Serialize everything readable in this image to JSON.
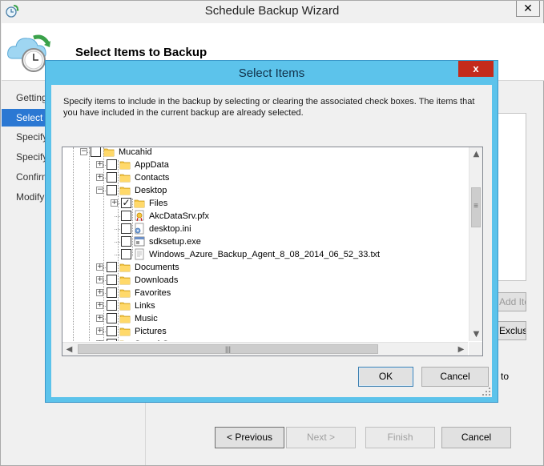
{
  "outer_window": {
    "title": "Schedule Backup Wizard",
    "close_glyph": "✕",
    "icon": "backup-schedule-icon"
  },
  "header": {
    "title": "Select Items to Backup",
    "icon": "cloud-clock-icon"
  },
  "steps": [
    {
      "label": "Getting Started",
      "active": false
    },
    {
      "label": "Select Items to Backup",
      "active": true
    },
    {
      "label": "Specify Backup Time",
      "active": false
    },
    {
      "label": "Specify Retention Policy",
      "active": false
    },
    {
      "label": "Confirmation",
      "active": false
    },
    {
      "label": "Modify Backup Progress",
      "active": false
    }
  ],
  "background_buttons": {
    "btn1_label": "Add Items",
    "btn2_label": "Exclusion Settings",
    "side_text": "to"
  },
  "bottom_buttons": {
    "previous": "< Previous",
    "next": "Next >",
    "finish": "Finish",
    "cancel": "Cancel"
  },
  "dialog": {
    "title": "Select Items",
    "close_glyph": "x",
    "instructions": "Specify items to include in the backup by selecting or clearing the associated check boxes. The items that you have included in the current backup are already selected.",
    "ok_label": "OK",
    "cancel_label": "Cancel",
    "tree": [
      {
        "label": "Mucahid",
        "icon": "folder",
        "expander": "minus",
        "checked": false
      },
      {
        "label": "AppData",
        "icon": "folder",
        "expander": "plus",
        "checked": false
      },
      {
        "label": "Contacts",
        "icon": "folder",
        "expander": "plus",
        "checked": false
      },
      {
        "label": "Desktop",
        "icon": "folder",
        "expander": "minus",
        "checked": false
      },
      {
        "label": "Files",
        "icon": "folder",
        "expander": "plus",
        "checked": true
      },
      {
        "label": "AkcDataSrv.pfx",
        "icon": "certificate-file",
        "expander": "none",
        "checked": false
      },
      {
        "label": "desktop.ini",
        "icon": "settings-file",
        "expander": "none",
        "checked": false
      },
      {
        "label": "sdksetup.exe",
        "icon": "executable-file",
        "expander": "none",
        "checked": false
      },
      {
        "label": "Windows_Azure_Backup_Agent_8_08_2014_06_52_33.txt",
        "icon": "text-file",
        "expander": "none",
        "checked": false
      },
      {
        "label": "Documents",
        "icon": "folder",
        "expander": "plus",
        "checked": false
      },
      {
        "label": "Downloads",
        "icon": "folder",
        "expander": "plus",
        "checked": false
      },
      {
        "label": "Favorites",
        "icon": "folder",
        "expander": "plus",
        "checked": false
      },
      {
        "label": "Links",
        "icon": "folder",
        "expander": "plus",
        "checked": false
      },
      {
        "label": "Music",
        "icon": "folder",
        "expander": "plus",
        "checked": false
      },
      {
        "label": "Pictures",
        "icon": "folder",
        "expander": "plus",
        "checked": false
      },
      {
        "label": "Saved Games",
        "icon": "folder",
        "expander": "plus",
        "checked": false
      }
    ],
    "scroll_glyphs": {
      "up": "▲",
      "down": "▼",
      "left": "◀",
      "right": "▶",
      "grip": "≡",
      "hgrip": "|||"
    }
  },
  "colors": {
    "dialog_frame": "#5cc3eb",
    "close_red": "#c42b1c",
    "step_active": "#2b78d3",
    "folder_yellow": "#f4c542"
  }
}
